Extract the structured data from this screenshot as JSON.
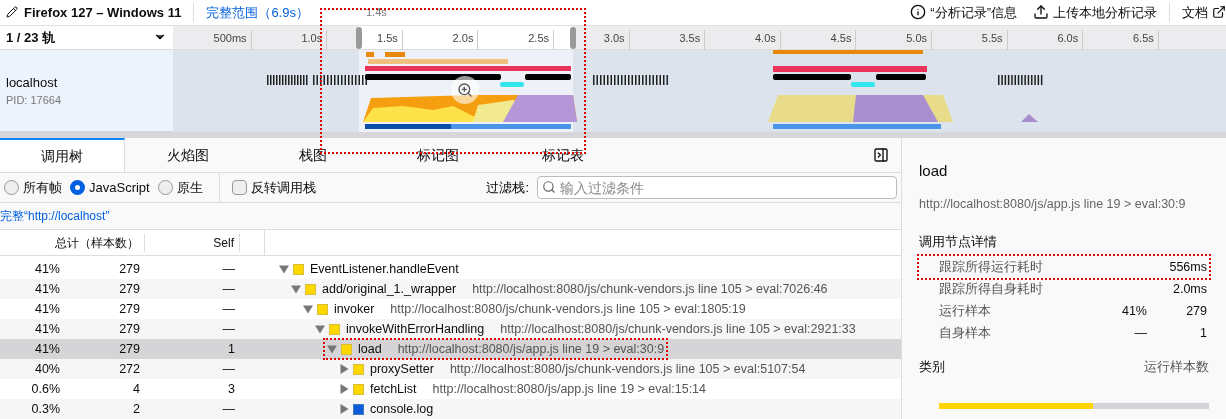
{
  "top_bar": {
    "title": "Firefox 127 – Windows 11",
    "range": "完整范围（6.9s）",
    "selection_duration": "1.4s",
    "info": "“分析记录”信息",
    "upload": "上传本地分析记录",
    "docs": "文档"
  },
  "timeline": {
    "track_count": "1 / 23 轨",
    "ticks": [
      "500ms",
      "1.0s",
      "1.5s",
      "2.0s",
      "2.5s",
      "3.0s",
      "3.5s",
      "4.0s",
      "4.5s",
      "5.0s",
      "5.5s",
      "6.0s",
      "6.5s"
    ],
    "selection_highlighted": true,
    "track": {
      "name": "localhost",
      "pid": "PID: 17664"
    }
  },
  "tabs": [
    {
      "label": "调用树",
      "selected": true
    },
    {
      "label": "火焰图",
      "selected": false
    },
    {
      "label": "栈图",
      "selected": false
    },
    {
      "label": "标记图",
      "selected": false
    },
    {
      "label": "标记表",
      "selected": false
    }
  ],
  "options": {
    "radios": [
      {
        "label": "所有帧",
        "selected": false
      },
      {
        "label": "JavaScript",
        "selected": true
      },
      {
        "label": "原生",
        "selected": false
      }
    ],
    "invert": {
      "label": "反转调用栈",
      "checked": false
    },
    "filter_label": "过滤栈:",
    "filter_placeholder": "输入过滤条件"
  },
  "breadcrumb": "完整“http://localhost”",
  "table": {
    "columns": [
      "总计（样本数）",
      "Self"
    ],
    "rows": [
      {
        "total": "41%",
        "samples": "279",
        "self": "—",
        "name": "EventListener.handleEvent",
        "color": "#ffd700",
        "expanded": true,
        "selected": false,
        "highlighted": false,
        "children": [
          {
            "total": "41%",
            "samples": "279",
            "self": "—",
            "name": "add/original_1._wrapper",
            "url": "http://localhost:8080/js/chunk-vendors.js line 105 > eval:7026:46",
            "color": "#ffd700",
            "expanded": true,
            "selected": false,
            "highlighted": false,
            "children": [
              {
                "total": "41%",
                "samples": "279",
                "self": "—",
                "name": "invoker",
                "url": "http://localhost:8080/js/chunk-vendors.js line 105 > eval:1805:19",
                "color": "#ffd700",
                "expanded": true,
                "selected": false,
                "highlighted": false,
                "children": [
                  {
                    "total": "41%",
                    "samples": "279",
                    "self": "—",
                    "name": "invokeWithErrorHandling",
                    "url": "http://localhost:8080/js/chunk-vendors.js line 105 > eval:2921:33",
                    "color": "#ffd700",
                    "expanded": true,
                    "selected": false,
                    "highlighted": false,
                    "children": [
                      {
                        "total": "41%",
                        "samples": "279",
                        "self": "1",
                        "name": "load",
                        "url": "http://localhost:8080/js/app.js line 19 > eval:30:9",
                        "color": "#ffd700",
                        "expanded": true,
                        "selected": true,
                        "highlighted": true,
                        "children": [
                          {
                            "total": "40%",
                            "samples": "272",
                            "self": "—",
                            "name": "proxySetter",
                            "url": "http://localhost:8080/js/chunk-vendors.js line 105 > eval:5107:54",
                            "color": "#ffd700",
                            "expanded": false,
                            "selected": false,
                            "highlighted": false
                          },
                          {
                            "total": "0.6%",
                            "samples": "4",
                            "self": "3",
                            "name": "fetchList",
                            "url": "http://localhost:8080/js/app.js line 19 > eval:15:14",
                            "color": "#ffd700",
                            "expanded": false,
                            "selected": false,
                            "highlighted": false
                          },
                          {
                            "total": "0.3%",
                            "samples": "2",
                            "self": "—",
                            "name": "console.log",
                            "color": "#0b5ed7",
                            "expanded": false,
                            "selected": false,
                            "highlighted": false
                          }
                        ]
                      }
                    ]
                  }
                ]
              }
            ]
          }
        ]
      }
    ]
  },
  "sidebar": {
    "title": "load",
    "url": "http://localhost:8080/js/app.js line 19 > eval:30:9",
    "section": "调用节点详情",
    "details": [
      {
        "label": "跟踪所得运行耗时",
        "value": "556ms",
        "highlighted": true
      },
      {
        "label": "跟踪所得自身耗时",
        "value": "2.0ms",
        "highlighted": false
      },
      {
        "label": "运行样本",
        "percent": "41%",
        "value": "279",
        "highlighted": false
      },
      {
        "label": "自身样本",
        "percent": "—",
        "value": "1",
        "highlighted": false
      }
    ],
    "category_header": "类别",
    "category_value_header": "运行样本数",
    "category_bar": {
      "level": 0.57
    }
  }
}
